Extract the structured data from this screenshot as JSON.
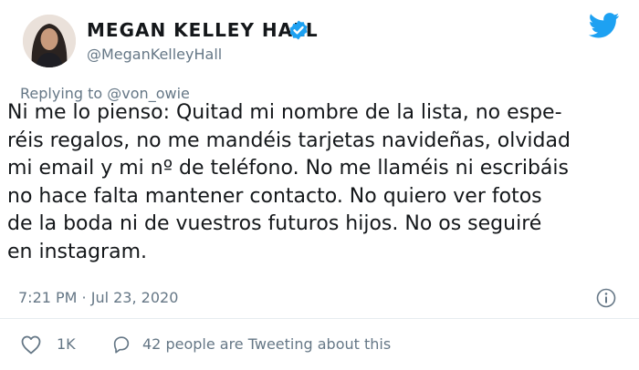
{
  "tweet": {
    "author_name": "MEGAN KELLEY HALL",
    "author_handle": "@MeganKelleyHall",
    "replying_prefix": "Replying to",
    "replying_to": "@von_owie",
    "body_lines": [
      "Ni me lo pienso: Quitad mi nombre de la lista, no espe-",
      "réis regalos, no me mandéis tarjetas navideñas, olvidad",
      "mi email y mi nº de teléfono. No me llaméis ni escribáis",
      "no hace falta mantener contacto. No quiero ver fotos",
      "de la boda ni de vuestros futuros hijos. No os seguiré",
      "en instagram."
    ],
    "timestamp": "7:21 PM · Jul 23, 2020",
    "likes": "1K",
    "conversation": "42 people are Tweeting about this"
  },
  "colors": {
    "brand": "#1da1f2",
    "secondary_text": "#657786",
    "primary_text": "#14171a"
  },
  "icons": {
    "verified": "verified-badge-icon",
    "logo": "twitter-bird-icon",
    "info": "info-icon",
    "like": "heart-icon",
    "conversation": "speech-bubble-icon"
  }
}
